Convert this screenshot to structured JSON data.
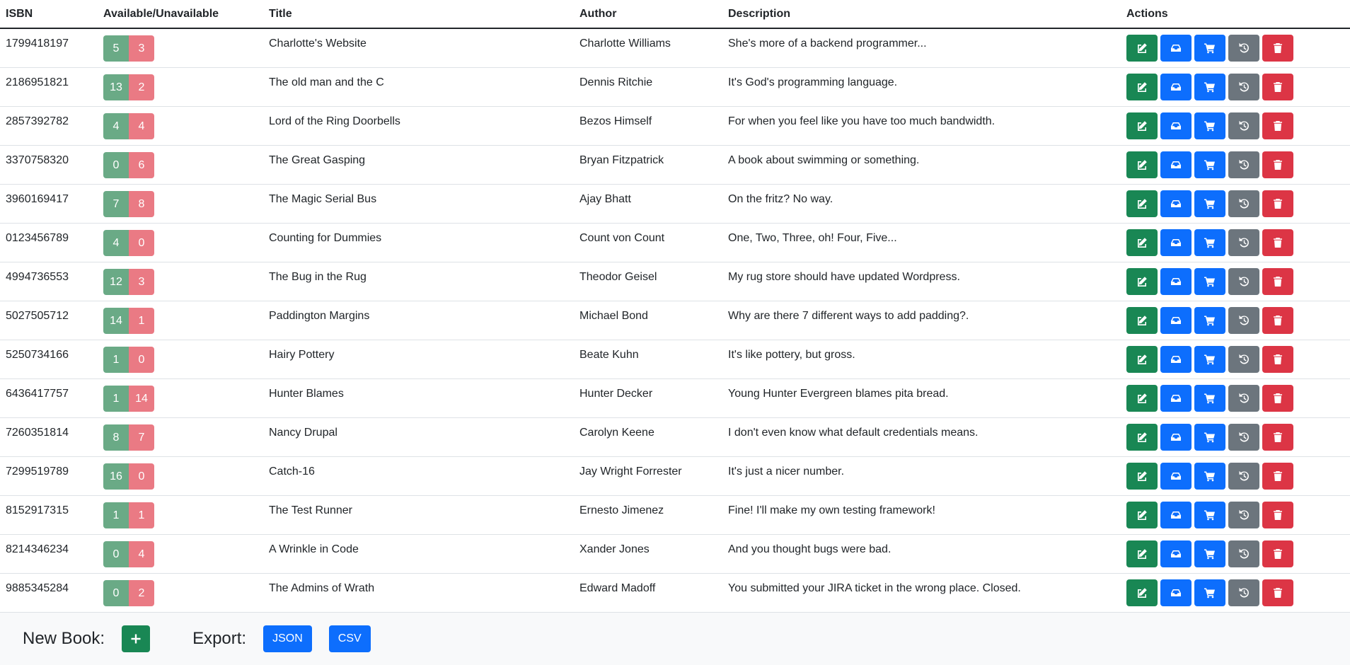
{
  "table": {
    "headers": {
      "isbn": "ISBN",
      "availability": "Available/Unavailable",
      "title": "Title",
      "author": "Author",
      "description": "Description",
      "actions": "Actions"
    },
    "rows": [
      {
        "isbn": "1799418197",
        "available": "5",
        "unavailable": "3",
        "title": "Charlotte's Website",
        "author": "Charlotte Williams",
        "description": "She's more of a backend programmer..."
      },
      {
        "isbn": "2186951821",
        "available": "13",
        "unavailable": "2",
        "title": "The old man and the C",
        "author": "Dennis Ritchie",
        "description": "It's God's programming language."
      },
      {
        "isbn": "2857392782",
        "available": "4",
        "unavailable": "4",
        "title": "Lord of the Ring Doorbells",
        "author": "Bezos Himself",
        "description": "For when you feel like you have too much bandwidth."
      },
      {
        "isbn": "3370758320",
        "available": "0",
        "unavailable": "6",
        "title": "The Great Gasping",
        "author": "Bryan Fitzpatrick",
        "description": "A book about swimming or something."
      },
      {
        "isbn": "3960169417",
        "available": "7",
        "unavailable": "8",
        "title": "The Magic Serial Bus",
        "author": "Ajay Bhatt",
        "description": "On the fritz? No way."
      },
      {
        "isbn": "0123456789",
        "available": "4",
        "unavailable": "0",
        "title": "Counting for Dummies",
        "author": "Count von Count",
        "description": "One, Two, Three, oh! Four, Five..."
      },
      {
        "isbn": "4994736553",
        "available": "12",
        "unavailable": "3",
        "title": "The Bug in the Rug",
        "author": "Theodor Geisel",
        "description": "My rug store should have updated Wordpress."
      },
      {
        "isbn": "5027505712",
        "available": "14",
        "unavailable": "1",
        "title": "Paddington Margins",
        "author": "Michael Bond",
        "description": "Why are there 7 different ways to add padding?."
      },
      {
        "isbn": "5250734166",
        "available": "1",
        "unavailable": "0",
        "title": "Hairy Pottery",
        "author": "Beate Kuhn",
        "description": "It's like pottery, but gross."
      },
      {
        "isbn": "6436417757",
        "available": "1",
        "unavailable": "14",
        "title": "Hunter Blames",
        "author": "Hunter Decker",
        "description": "Young Hunter Evergreen blames pita bread."
      },
      {
        "isbn": "7260351814",
        "available": "8",
        "unavailable": "7",
        "title": "Nancy Drupal",
        "author": "Carolyn Keene",
        "description": "I don't even know what default credentials means."
      },
      {
        "isbn": "7299519789",
        "available": "16",
        "unavailable": "0",
        "title": "Catch-16",
        "author": "Jay Wright Forrester",
        "description": "It's just a nicer number."
      },
      {
        "isbn": "8152917315",
        "available": "1",
        "unavailable": "1",
        "title": "The Test Runner",
        "author": "Ernesto Jimenez",
        "description": "Fine! I'll make my own testing framework!"
      },
      {
        "isbn": "8214346234",
        "available": "0",
        "unavailable": "4",
        "title": "A Wrinkle in Code",
        "author": "Xander Jones",
        "description": "And you thought bugs were bad."
      },
      {
        "isbn": "9885345284",
        "available": "0",
        "unavailable": "2",
        "title": "The Admins of Wrath",
        "author": "Edward Madoff",
        "description": "You submitted your JIRA ticket in the wrong place. Closed."
      }
    ],
    "action_icons": [
      "edit-icon",
      "inbox-icon",
      "cart-icon",
      "history-icon",
      "trash-icon"
    ]
  },
  "footer": {
    "new_book_label": "New Book:",
    "new_book_icon": "plus-icon",
    "export_label": "Export:",
    "json_label": "JSON",
    "csv_label": "CSV"
  },
  "colors": {
    "available_badge": "#6aaa86",
    "unavailable_badge": "#ea7a84",
    "edit_button": "#198754",
    "checkin_button": "#0d6efd",
    "checkout_button": "#0d6efd",
    "history_button": "#6c757d",
    "delete_button": "#dc3545",
    "footer_background": "#f8f9fa"
  }
}
